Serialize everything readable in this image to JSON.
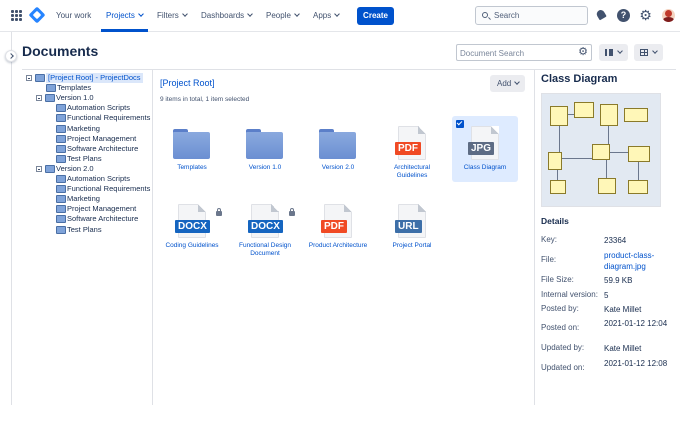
{
  "nav": {
    "items": [
      {
        "label": "Your work",
        "dropdown": false,
        "active": false
      },
      {
        "label": "Projects",
        "dropdown": true,
        "active": true
      },
      {
        "label": "Filters",
        "dropdown": true,
        "active": false
      },
      {
        "label": "Dashboards",
        "dropdown": true,
        "active": false
      },
      {
        "label": "People",
        "dropdown": true,
        "active": false
      },
      {
        "label": "Apps",
        "dropdown": true,
        "active": false
      }
    ],
    "create_label": "Create",
    "search_placeholder": "Search",
    "icons": [
      "app-switcher-icon",
      "product-logo-icon",
      "notifications-icon",
      "help-icon",
      "settings-icon",
      "avatar"
    ],
    "help_glyph": "?",
    "gear_glyph": "⚙",
    "accent": "#0052cc"
  },
  "page": {
    "title": "Documents",
    "doc_search_placeholder": "Document Search",
    "doc_search_icon_glyph": "⚙"
  },
  "tree": {
    "nodes": [
      {
        "label": "[Project Root] - ProjectDocs",
        "level": 0,
        "toggle": true,
        "selected": true
      },
      {
        "label": "Templates",
        "level": 1,
        "toggle": false
      },
      {
        "label": "Version 1.0",
        "level": 1,
        "toggle": true
      },
      {
        "label": "Automation Scripts",
        "level": 2,
        "toggle": false
      },
      {
        "label": "Functional Requirements",
        "level": 2,
        "toggle": false
      },
      {
        "label": "Marketing",
        "level": 2,
        "toggle": false
      },
      {
        "label": "Project Management",
        "level": 2,
        "toggle": false
      },
      {
        "label": "Software Architecture",
        "level": 2,
        "toggle": false
      },
      {
        "label": "Test Plans",
        "level": 2,
        "toggle": false
      },
      {
        "label": "Version 2.0",
        "level": 1,
        "toggle": true
      },
      {
        "label": "Automation Scripts",
        "level": 2,
        "toggle": false
      },
      {
        "label": "Functional Requirements",
        "level": 2,
        "toggle": false
      },
      {
        "label": "Marketing",
        "level": 2,
        "toggle": false
      },
      {
        "label": "Project Management",
        "level": 2,
        "toggle": false
      },
      {
        "label": "Software Architecture",
        "level": 2,
        "toggle": false
      },
      {
        "label": "Test Plans",
        "level": 2,
        "toggle": false
      }
    ]
  },
  "content": {
    "breadcrumb": "[Project Root]",
    "count_text": "9 items in total, 1 item selected",
    "add_label": "Add",
    "tiles": [
      {
        "label": "Templates",
        "kind": "folder"
      },
      {
        "label": "Version 1.0",
        "kind": "folder"
      },
      {
        "label": "Version 2.0",
        "kind": "folder"
      },
      {
        "label": "Architectural Guidelines",
        "kind": "file",
        "badge": "PDF",
        "color": "#f04a24",
        "locked": false
      },
      {
        "label": "Class Diagram",
        "kind": "file",
        "badge": "JPG",
        "color": "#5e6c84",
        "locked": false,
        "selected": true
      },
      {
        "label": "Coding Guidelines",
        "kind": "file",
        "badge": "DOCX",
        "color": "#1565c0",
        "locked": true
      },
      {
        "label": "Functional Design Document",
        "kind": "file",
        "badge": "DOCX",
        "color": "#1565c0",
        "locked": true
      },
      {
        "label": "Product Architecture",
        "kind": "file",
        "badge": "PDF",
        "color": "#f04a24",
        "locked": false
      },
      {
        "label": "Project Portal",
        "kind": "file",
        "badge": "URL",
        "color": "#3d6fa8",
        "locked": false
      }
    ]
  },
  "details": {
    "title": "Class Diagram",
    "heading": "Details",
    "rows": [
      {
        "key": "Key:",
        "value": "23364",
        "link": false
      },
      {
        "key": "File:",
        "value": "product-class-diagram.jpg",
        "link": true
      },
      {
        "key": "File Size:",
        "value": "59.9 KB",
        "link": false
      },
      {
        "key": "Internal version:",
        "value": "5",
        "link": false
      },
      {
        "key": "Posted by:",
        "value": "Kate Millet",
        "link": false
      },
      {
        "key": "Posted on:",
        "value": "2021-01-12 12:04",
        "link": false
      },
      {
        "key": "Updated by:",
        "value": "Kate Millet",
        "link": false
      },
      {
        "key": "Updated on:",
        "value": "2021-01-12 12:08",
        "link": false
      }
    ]
  }
}
